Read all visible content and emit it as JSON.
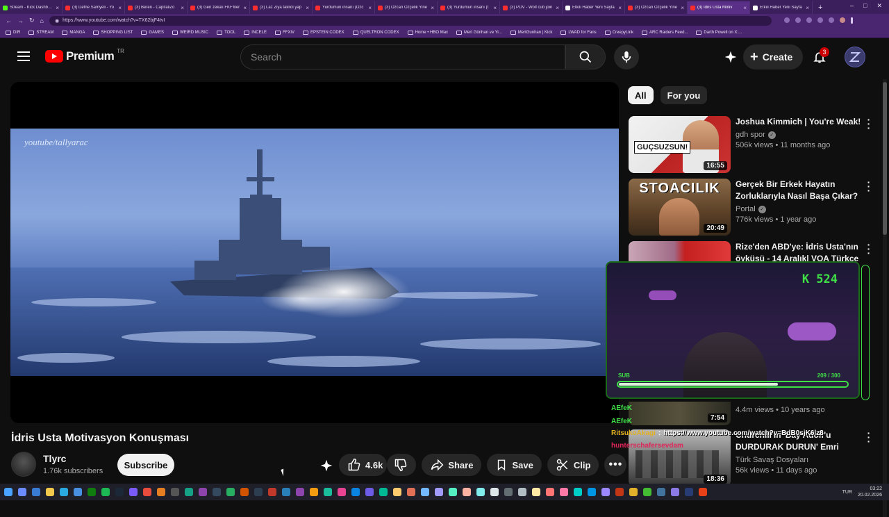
{
  "browser": {
    "tabs": [
      {
        "title": "Stream - Kick Dashboard",
        "color": "#53fc18"
      },
      {
        "title": "(3) Defne Samyeli - Yo",
        "color": "#ff2d2d"
      },
      {
        "title": "(3) Beren - CapitaliZo",
        "color": "#ff2d2d"
      },
      {
        "title": "(3) Geri zekalı FKF'liler",
        "color": "#ff2d2d"
      },
      {
        "title": "(3) Laz Ziya taklidi yap",
        "color": "#ff2d2d"
      },
      {
        "title": "Yurdumun insanı (Özc",
        "color": "#ff2d2d"
      },
      {
        "title": "(3) Özcan Özçelik Yine",
        "color": "#ff2d2d"
      },
      {
        "title": "(3) Yurdumun insanı (t",
        "color": "#ff2d2d"
      },
      {
        "title": "(3) POV - Wolf cub join",
        "color": "#ff2d2d"
      },
      {
        "title": "Etkili Haber Yeni Sayfa",
        "color": "#ffffff"
      },
      {
        "title": "(3) Özcan Özçelik Yine",
        "color": "#ff2d2d"
      },
      {
        "title": "(3) İdris Usta Motiv",
        "color": "#ff2d2d",
        "active": true
      },
      {
        "title": "Etkili Haber Yeni Sayfa",
        "color": "#ffffff"
      }
    ],
    "new_tab": "+",
    "window_controls": [
      "–",
      "□",
      "✕"
    ],
    "url": "https://www.youtube.com/watch?v=TX62bjF4tvI",
    "bookmarks": [
      "DIR",
      "STREAM",
      "MANGA",
      "SHOPPING LIST",
      "GAMES",
      "WEIRD MUSIC",
      "TOOL",
      "INCELE",
      "FFXIV",
      "EPSTEIN CODEX",
      "QUELTRON CODEX",
      "Home • HBO Max",
      "Mert Günhan ve Yi...",
      "MertGunhan | Kick",
      "LWAD for Fans",
      "CreepyLink",
      "ARC Raiders Feed...",
      "Darth Powell on X:..."
    ]
  },
  "header": {
    "brand": "Premium",
    "country": "TR",
    "search_placeholder": "Search",
    "create_label": "Create",
    "notif_count": "3"
  },
  "video": {
    "watermark": "youtube/tallyarac",
    "title": "İdris Usta Motivasyon Konuşması",
    "channel": "Tlyrc",
    "subscribers": "1.76k subscribers",
    "subscribe_label": "Subscribe",
    "likes": "4.6k",
    "share_label": "Share",
    "save_label": "Save",
    "clip_label": "Clip"
  },
  "chips": [
    "All",
    "For you"
  ],
  "recommendations": [
    {
      "title": "Joshua Kimmich | You're Weak!",
      "channel": "gdh spor",
      "verified": true,
      "meta": "506k views • 11 months ago",
      "duration": "16:55",
      "thumb_text": "GUÇSUZSUN!"
    },
    {
      "title": "Gerçek Bir Erkek Hayatın Zorluklarıyla Nasıl Başa Çıkar?",
      "channel": "Portal",
      "verified": true,
      "meta": "776k views • 1 year ago",
      "duration": "20:49",
      "thumb_text": "STOACILIK"
    },
    {
      "title": "Rize'den ABD'ye: İdris Usta'nın öyküsü - 14 Aralık| VOA Türkçe",
      "channel": "",
      "verified": false,
      "meta": "",
      "duration": "",
      "thumb_text": ""
    },
    {
      "title": "",
      "channel": "",
      "verified": false,
      "meta": "4.4m views • 10 years ago",
      "duration": "7:54",
      "thumb_text": ""
    },
    {
      "title": "Churchill'in 'Bay Adolf'u DURDURAK DURUN' Emri Verdiğinde 💀 ...",
      "channel": "Türk Savaş Dosyaları",
      "verified": false,
      "meta": "56k views • 11 days ago",
      "duration": "18:36",
      "thumb_text": ""
    }
  ],
  "overlay": {
    "score": "K 524",
    "sub_label": "SUB",
    "sub_count": "209 / 300",
    "sub_progress": 0.697,
    "chat": [
      {
        "user": "AEfeK",
        "text": "",
        "color": "#3ee046"
      },
      {
        "user": "AEfeK",
        "text": "",
        "color": "#3ee046"
      },
      {
        "user": "RitsukoAkagi",
        "text": "https://www.youtube.com/watch?v=BdB0sjK6lz8",
        "color": "#e0b020"
      },
      {
        "user": "hunterschafersevdam",
        "text": "",
        "color": "#e0265a"
      }
    ]
  },
  "taskbar": {
    "language": "TUR",
    "time": "03:22",
    "date": "20.02.2026"
  }
}
